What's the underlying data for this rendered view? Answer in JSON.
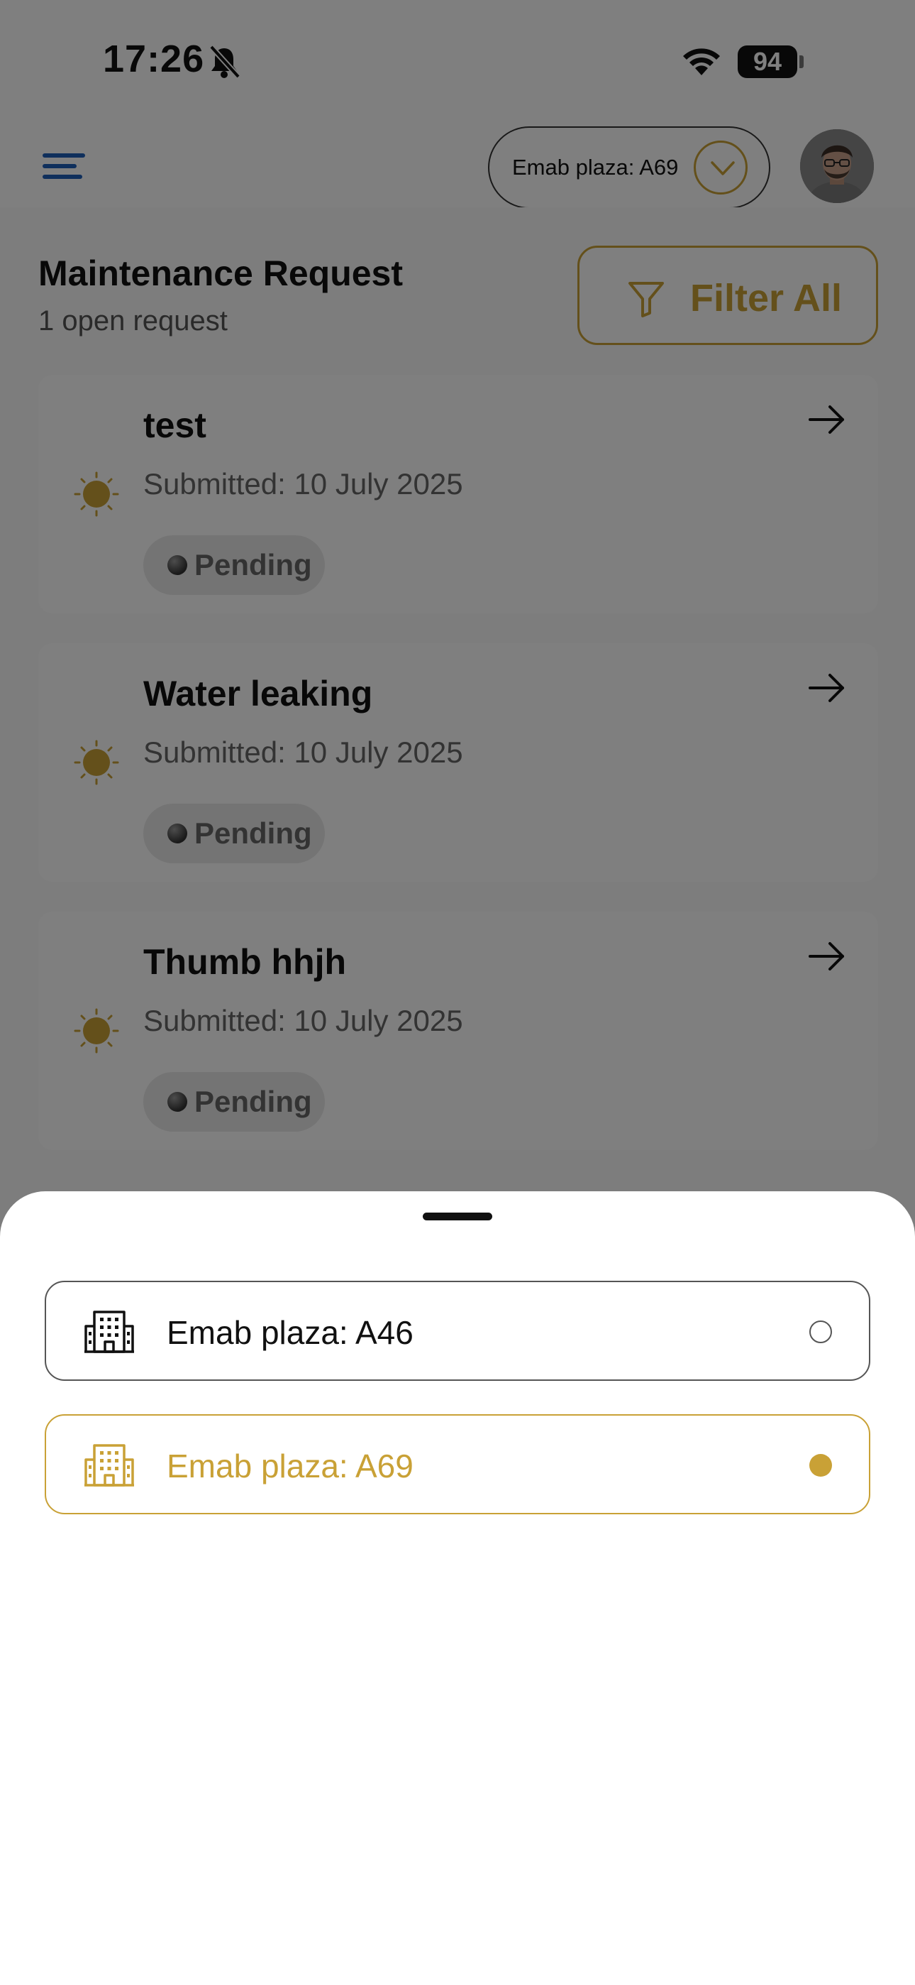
{
  "status_bar": {
    "time": "17:26",
    "battery": "94"
  },
  "header": {
    "selected_unit": "Emab plaza: A69"
  },
  "page": {
    "title": "Maintenance Request",
    "subtitle": "1 open request",
    "filter_label": "Filter All"
  },
  "requests": [
    {
      "title": "test",
      "submitted": "Submitted: 10 July 2025",
      "status": "Pending"
    },
    {
      "title": "Water leaking",
      "submitted": "Submitted: 10 July 2025",
      "status": "Pending"
    },
    {
      "title": "Thumb hhjh",
      "submitted": "Submitted: 10 July 2025",
      "status": "Pending"
    }
  ],
  "sheet": {
    "options": [
      {
        "label": "Emab plaza: A46",
        "selected": false
      },
      {
        "label": "Emab plaza: A69",
        "selected": true
      }
    ]
  },
  "colors": {
    "accent": "#c9a136",
    "menu": "#1f5fb8",
    "overlay": "rgba(0,0,0,0.5)"
  },
  "icons": [
    "bell-slash-icon",
    "wifi-icon",
    "menu-icon",
    "chevron-down-icon",
    "filter-icon",
    "sun-icon",
    "arrow-right-icon",
    "building-icon"
  ]
}
